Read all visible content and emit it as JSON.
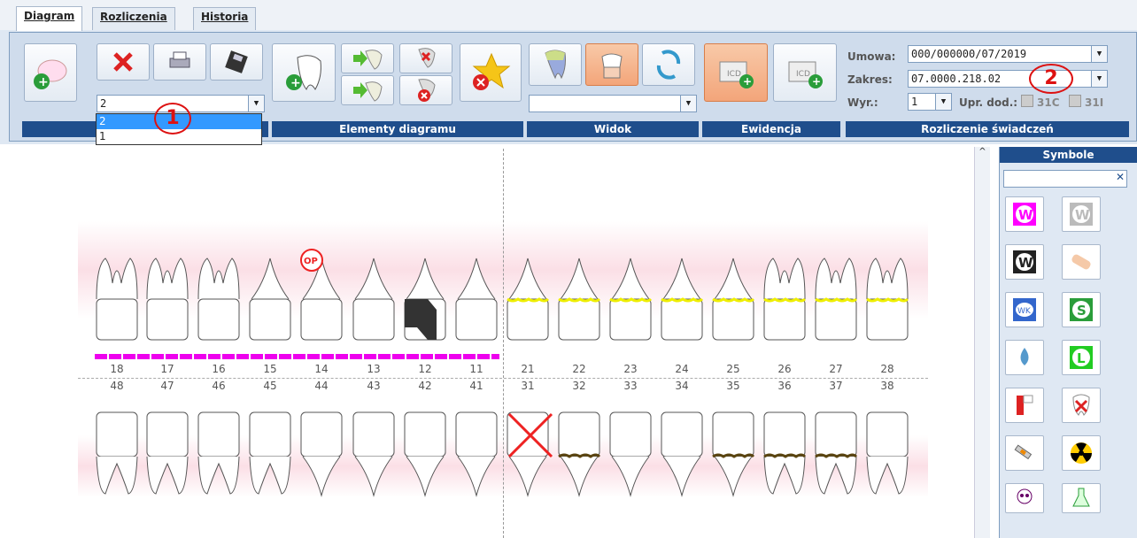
{
  "tabs": [
    "Diagram",
    "Rozliczenia",
    "Historia"
  ],
  "toolbar": {
    "group_labels": [
      "Elementy diagramu",
      "Widok",
      "Ewidencja",
      "Rozliczenie świadczeń"
    ],
    "combo_value": "2",
    "dropdown_options": [
      "2",
      "1"
    ],
    "umowa_label": "Umowa:",
    "umowa_value": "000/000000/07/2019",
    "zakres_label": "Zakres:",
    "zakres_value": "07.0000.218.02",
    "wyr_label": "Wyr.:",
    "wyr_value": "1",
    "upr_label": "Upr. dod.:",
    "cb1": "31C",
    "cb2": "31I"
  },
  "callouts": [
    "1",
    "2"
  ],
  "teeth": {
    "upper_numbers": [
      "18",
      "17",
      "16",
      "15",
      "14",
      "13",
      "12",
      "11",
      "21",
      "22",
      "23",
      "24",
      "25",
      "26",
      "27",
      "28"
    ],
    "lower_numbers": [
      "48",
      "47",
      "46",
      "45",
      "44",
      "43",
      "42",
      "41",
      "31",
      "32",
      "33",
      "34",
      "35",
      "36",
      "37",
      "38"
    ],
    "op_badge": "OP"
  },
  "symbols": {
    "title": "Symbole"
  }
}
